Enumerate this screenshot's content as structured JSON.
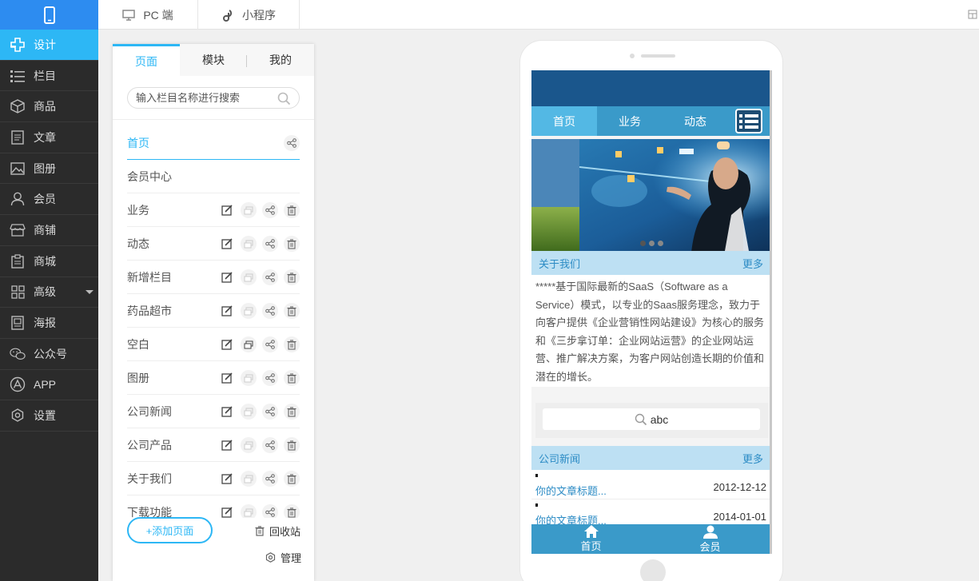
{
  "topbar": {
    "tabs": [
      {
        "label": "PC 端",
        "icon": "monitor-icon"
      },
      {
        "label": "小程序",
        "icon": "mini-program-icon"
      }
    ]
  },
  "sidebar": {
    "items": [
      {
        "label": "设计",
        "icon": "design-icon",
        "active": true
      },
      {
        "label": "栏目",
        "icon": "list-icon"
      },
      {
        "label": "商品",
        "icon": "box-icon"
      },
      {
        "label": "文章",
        "icon": "article-icon"
      },
      {
        "label": "图册",
        "icon": "image-icon"
      },
      {
        "label": "会员",
        "icon": "user-icon"
      },
      {
        "label": "商铺",
        "icon": "shop-icon"
      },
      {
        "label": "商城",
        "icon": "clipboard-icon"
      },
      {
        "label": "高级",
        "icon": "grid-icon"
      },
      {
        "label": "海报",
        "icon": "poster-icon"
      },
      {
        "label": "公众号",
        "icon": "wechat-icon"
      },
      {
        "label": "APP",
        "icon": "app-icon"
      },
      {
        "label": "设置",
        "icon": "gear-icon"
      }
    ]
  },
  "panel": {
    "tabs": [
      {
        "label": "页面",
        "active": true
      },
      {
        "label": "模块"
      },
      {
        "label": "我的"
      }
    ],
    "search_placeholder": "输入栏目名称进行搜索",
    "pages": [
      {
        "label": "首页"
      },
      {
        "label": "会员中心"
      },
      {
        "label": "业务"
      },
      {
        "label": "动态"
      },
      {
        "label": "新增栏目"
      },
      {
        "label": "药品超市"
      },
      {
        "label": "空白"
      },
      {
        "label": "图册"
      },
      {
        "label": "公司新闻"
      },
      {
        "label": "公司产品"
      },
      {
        "label": "关于我们"
      },
      {
        "label": "下载功能"
      }
    ],
    "add_page_label": "+添加页面",
    "recycle_label": "回收站",
    "manage_label": "管理"
  },
  "phone": {
    "nav": [
      {
        "label": "首页",
        "active": true
      },
      {
        "label": "业务"
      },
      {
        "label": "动态"
      }
    ],
    "about": {
      "title": "关于我们",
      "more": "更多",
      "text": "*****基于国际最新的SaaS（Software as a Service）模式，以专业的Saas服务理念，致力于向客户提供《企业营销性网站建设》为核心的服务和《三步拿订单：企业网站运营》的企业网站运营、推广解决方案，为客户网站创造长期的价值和潜在的增长。"
    },
    "search_text": "abc",
    "news": {
      "title": "公司新闻",
      "more": "更多",
      "items": [
        {
          "title": "你的文章标题...",
          "date": "2012-12-12"
        },
        {
          "title": "你的文章标题...",
          "date": "2014-01-01"
        }
      ]
    },
    "bottom_nav": [
      {
        "label": "首页",
        "icon": "home-icon"
      },
      {
        "label": "会员",
        "icon": "member-icon"
      }
    ]
  },
  "colors": {
    "accent": "#2db7f5",
    "sidebar_bg": "#2b2b2b",
    "phone_nav": "#3a9ac9",
    "phone_banner": "#1a568c",
    "section_head": "#bde0f3"
  }
}
